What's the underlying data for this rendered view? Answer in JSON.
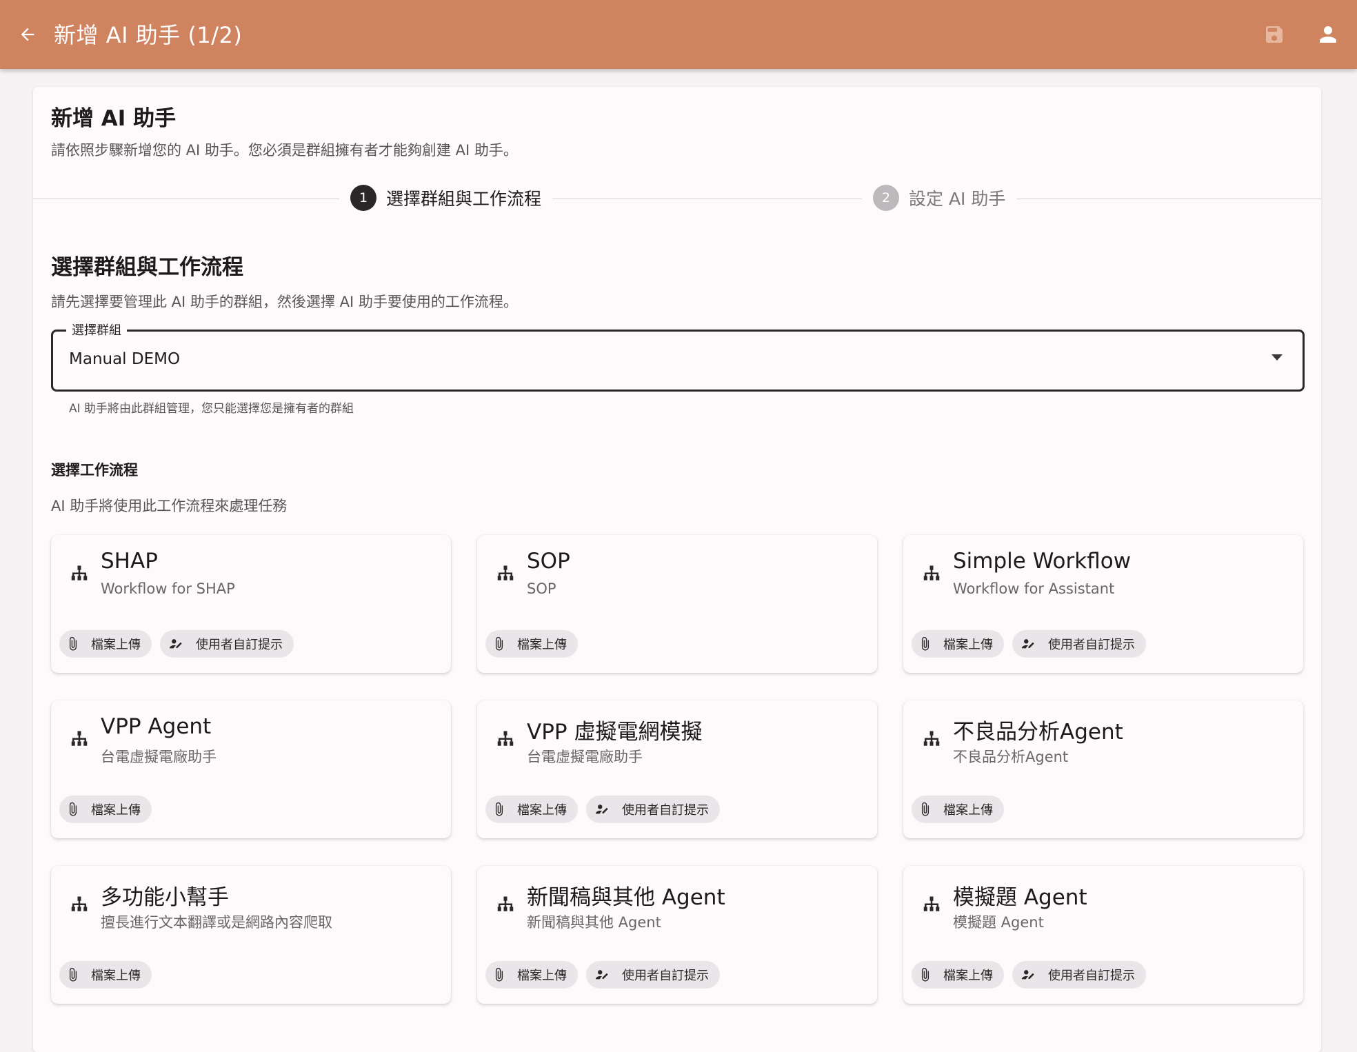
{
  "appbar": {
    "title": "新增 AI 助手 (1/2)",
    "color": "#cf835f",
    "icons": [
      "arrow-left-icon",
      "save-icon",
      "account-icon"
    ]
  },
  "header": {
    "title": "新增 AI 助手",
    "subtitle": "請依照步驟新增您的 AI 助手。您必須是群組擁有者才能夠創建 AI 助手。"
  },
  "stepper": {
    "steps": [
      {
        "number": "1",
        "label": "選擇群組與工作流程",
        "active": true
      },
      {
        "number": "2",
        "label": "設定 AI 助手",
        "active": false
      }
    ]
  },
  "section": {
    "title": "選擇群組與工作流程",
    "subtitle": "請先選擇要管理此 AI 助手的群組，然後選擇 AI 助手要使用的工作流程。"
  },
  "group_select": {
    "label": "選擇群組",
    "value": "Manual DEMO",
    "helper": "AI 助手將由此群組管理，您只能選擇您是擁有者的群組"
  },
  "workflow_section": {
    "title": "選擇工作流程",
    "subtitle": "AI 助手將使用此工作流程來處理任務"
  },
  "chip_labels": {
    "upload": "檔案上傳",
    "prompt": "使用者自訂提示"
  },
  "workflows": [
    {
      "name": "SHAP",
      "desc": "Workflow for SHAP",
      "chips": [
        "檔案上傳",
        "使用者自訂提示"
      ]
    },
    {
      "name": "SOP",
      "desc": "SOP",
      "chips": [
        "檔案上傳"
      ]
    },
    {
      "name": "Simple Workflow",
      "desc": "Workflow for Assistant",
      "chips": [
        "檔案上傳",
        "使用者自訂提示"
      ]
    },
    {
      "name": "VPP Agent",
      "desc": "台電虛擬電廠助手",
      "chips": [
        "檔案上傳"
      ]
    },
    {
      "name": "VPP 虛擬電網模擬",
      "desc": "台電虛擬電廠助手",
      "chips": [
        "檔案上傳",
        "使用者自訂提示"
      ]
    },
    {
      "name": "不良品分析Agent",
      "desc": "不良品分析Agent",
      "chips": [
        "檔案上傳"
      ]
    },
    {
      "name": "多功能小幫手",
      "desc": "擅長進行文本翻譯或是網路內容爬取",
      "chips": [
        "檔案上傳"
      ]
    },
    {
      "name": "新聞稿與其他 Agent",
      "desc": "新聞稿與其他 Agent",
      "chips": [
        "檔案上傳",
        "使用者自訂提示"
      ]
    },
    {
      "name": "模擬題 Agent",
      "desc": "模擬題 Agent",
      "chips": [
        "檔案上傳",
        "使用者自訂提示"
      ]
    }
  ]
}
